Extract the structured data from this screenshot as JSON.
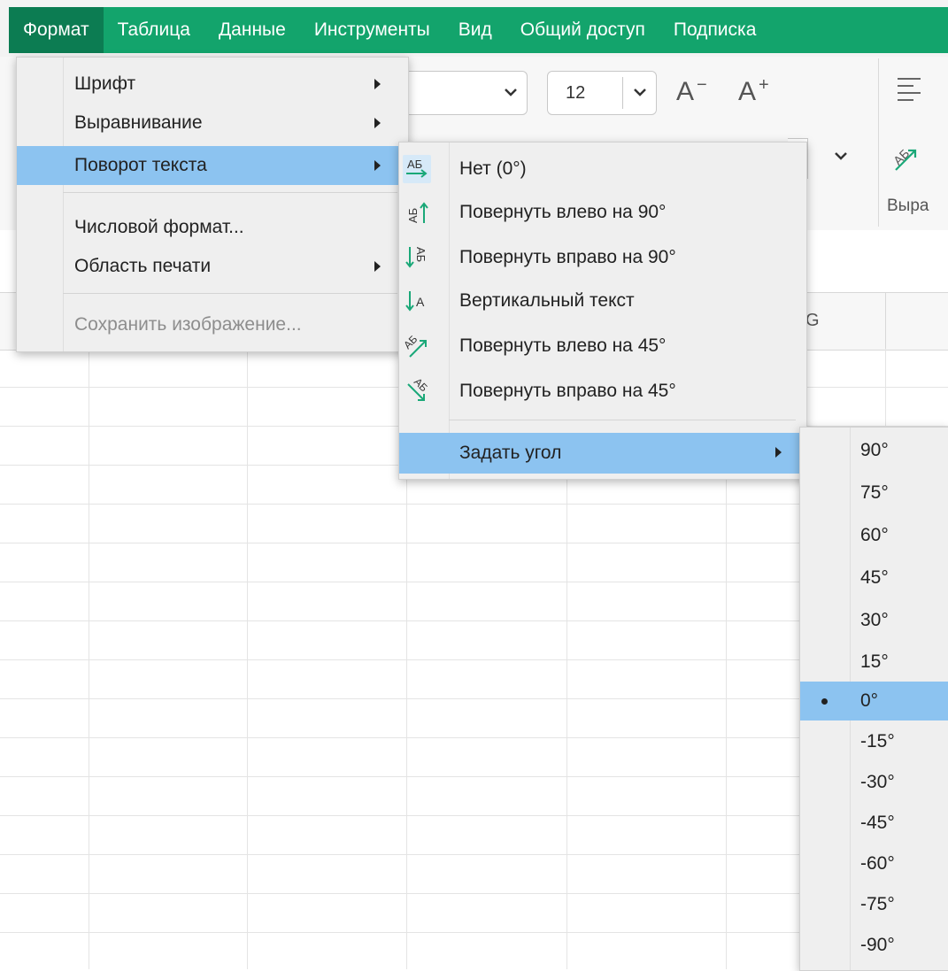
{
  "menubar": {
    "items": [
      {
        "label": "Формат",
        "active": true
      },
      {
        "label": "Таблица"
      },
      {
        "label": "Данные"
      },
      {
        "label": "Инструменты"
      },
      {
        "label": "Вид"
      },
      {
        "label": "Общий доступ"
      },
      {
        "label": "Подписка"
      }
    ]
  },
  "toolbar": {
    "font_size": "12",
    "font_size_decrease": "A",
    "font_size_increase": "A",
    "alignment_group_label": "Выра"
  },
  "format_menu": {
    "items": [
      {
        "label": "Шрифт",
        "has_submenu": true
      },
      {
        "label": "Выравнивание",
        "has_submenu": true
      },
      {
        "label": "Поворот текста",
        "has_submenu": true,
        "highlighted": true
      },
      {
        "label": "Числовой формат...",
        "has_submenu": false
      },
      {
        "label": "Область печати",
        "has_submenu": true
      },
      {
        "label": "Сохранить изображение...",
        "disabled": true
      }
    ]
  },
  "rotation_menu": {
    "items": [
      {
        "label": "Нет (0°)",
        "icon": "no-rotation-icon"
      },
      {
        "label": "Повернуть влево на 90°",
        "icon": "rotate-left-90-icon"
      },
      {
        "label": "Повернуть вправо на 90°",
        "icon": "rotate-right-90-icon"
      },
      {
        "label": "Вертикальный текст",
        "icon": "vertical-text-icon"
      },
      {
        "label": "Повернуть влево на 45°",
        "icon": "rotate-left-45-icon"
      },
      {
        "label": "Повернуть вправо на 45°",
        "icon": "rotate-right-45-icon"
      },
      {
        "label": "Задать угол",
        "has_submenu": true,
        "highlighted": true
      }
    ],
    "icon_text": "АБ",
    "icon_letter": "А"
  },
  "angle_menu": {
    "selected": "0°",
    "options": [
      "90°",
      "75°",
      "60°",
      "45°",
      "30°",
      "15°",
      "0°",
      "-15°",
      "-30°",
      "-45°",
      "-60°",
      "-75°",
      "-90°"
    ]
  },
  "sheet": {
    "partial_column_letter": "G"
  },
  "colors": {
    "menubar_green": "#13a46c",
    "menubar_active": "#0c7c52",
    "menu_highlight": "#8cc3f0",
    "icon_accent": "#1aa878"
  }
}
